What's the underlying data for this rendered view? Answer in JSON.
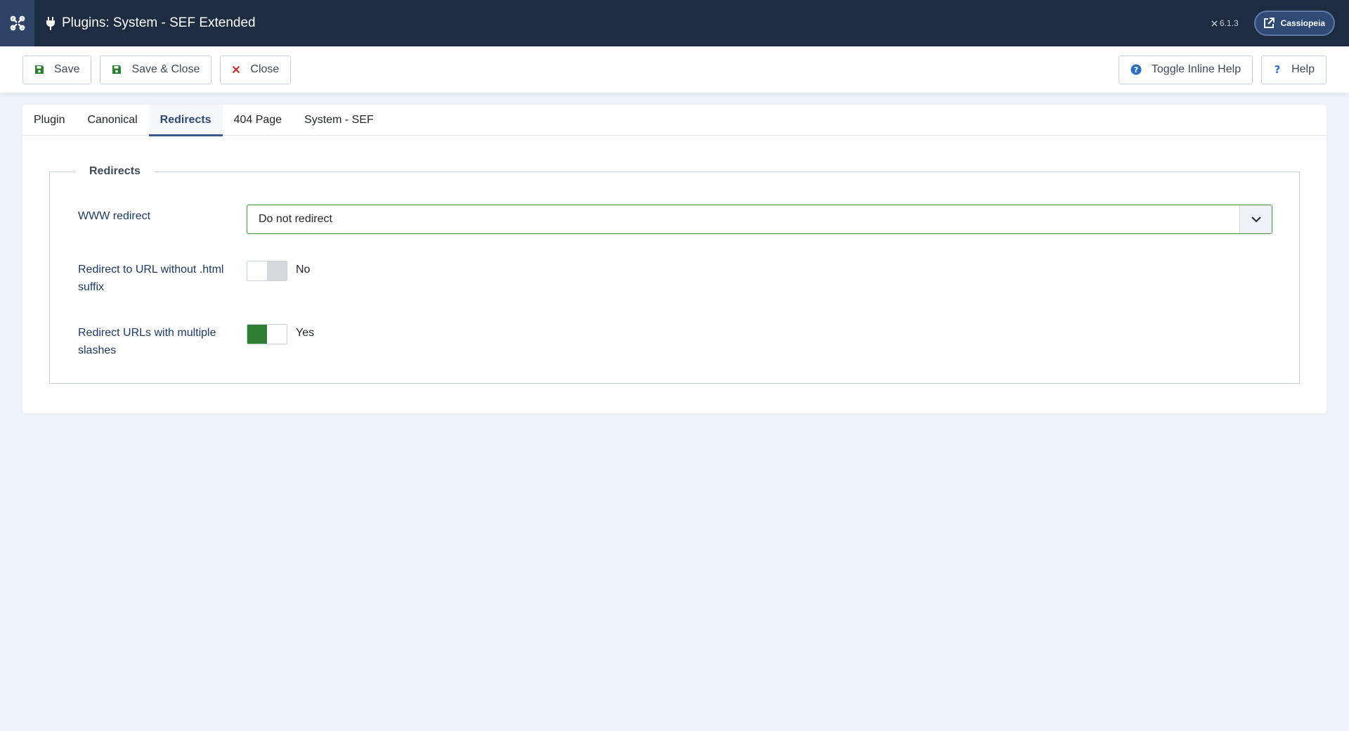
{
  "header": {
    "title": "Plugins: System - SEF Extended",
    "version": "6.1.3",
    "site_button": "Cassiopeia"
  },
  "toolbar": {
    "save_label": "Save",
    "save_close_label": "Save & Close",
    "close_label": "Close",
    "toggle_help_label": "Toggle Inline Help",
    "help_label": "Help"
  },
  "tabs": [
    {
      "label": "Plugin",
      "active": false
    },
    {
      "label": "Canonical",
      "active": false
    },
    {
      "label": "Redirects",
      "active": true
    },
    {
      "label": "404 Page",
      "active": false
    },
    {
      "label": "System - SEF",
      "active": false
    }
  ],
  "form": {
    "legend": "Redirects",
    "www_redirect": {
      "label": "WWW redirect",
      "value": "Do not redirect"
    },
    "html_suffix": {
      "label": "Redirect to URL without .html suffix",
      "state": "No"
    },
    "multiple_slashes": {
      "label": "Redirect URLs with multiple slashes",
      "state": "Yes"
    }
  },
  "colors": {
    "header_bg": "#1e2c42",
    "accent": "#2f4a75",
    "save_icon": "#2e7d32",
    "close_icon": "#c62828",
    "help_icon": "#2f6fc0",
    "switch_on": "#2e7d32"
  },
  "icons": {
    "logo": "joomla-logo-icon",
    "title": "plug-icon",
    "site": "external-link-icon",
    "save": "save-icon",
    "save_close": "save-icon",
    "close": "close-icon",
    "toggle_help": "question-circle-icon",
    "help": "question-icon",
    "select": "chevron-down-icon"
  }
}
